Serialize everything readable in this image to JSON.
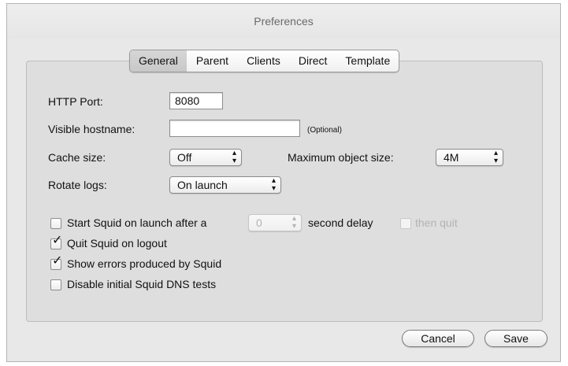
{
  "window": {
    "title": "Preferences"
  },
  "tabs": [
    {
      "label": "General",
      "selected": true
    },
    {
      "label": "Parent"
    },
    {
      "label": "Clients"
    },
    {
      "label": "Direct"
    },
    {
      "label": "Template"
    }
  ],
  "general": {
    "http_port_label": "HTTP Port:",
    "http_port_value": "8080",
    "visible_hostname_label": "Visible hostname:",
    "visible_hostname_value": "",
    "optional_note": "(Optional)",
    "cache_size_label": "Cache size:",
    "cache_size_value": "Off",
    "max_object_size_label": "Maximum object size:",
    "max_object_size_value": "4M",
    "rotate_logs_label": "Rotate logs:",
    "rotate_logs_value": "On launch"
  },
  "options": {
    "start_on_launch_label": "Start Squid on launch after a",
    "start_on_launch_checked": false,
    "delay_value": "0",
    "delay_suffix": "second delay",
    "then_quit_label": "then quit",
    "then_quit_enabled": false,
    "quit_on_logout_label": "Quit Squid on logout",
    "quit_on_logout_checked": true,
    "show_errors_label": "Show errors produced by Squid",
    "show_errors_checked": true,
    "disable_dns_label": "Disable initial Squid DNS tests",
    "disable_dns_checked": false
  },
  "buttons": {
    "cancel": "Cancel",
    "save": "Save"
  },
  "icons": {
    "popup_arrows": "up-down-arrows-icon",
    "checkmark": "checkmark-icon"
  }
}
